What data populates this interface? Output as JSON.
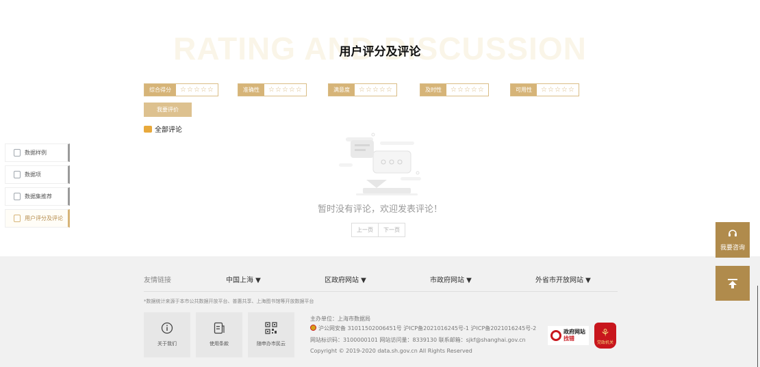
{
  "section": {
    "bg_title": "RATING AND DISCUSSION",
    "title": "用户评分及评论"
  },
  "ratings": [
    {
      "label": "综合得分",
      "stars": 0
    },
    {
      "label": "准确性",
      "stars": 0
    },
    {
      "label": "满意度",
      "stars": 0
    },
    {
      "label": "及时性",
      "stars": 0
    },
    {
      "label": "可用性",
      "stars": 0
    }
  ],
  "star_glyph": "☆",
  "rate_button": "我要评价",
  "all_comments": "全部评论",
  "empty_message": "暂时没有评论，欢迎发表评论！",
  "pager": {
    "prev": "上一页",
    "next": "下一页"
  },
  "side_nav": [
    {
      "label": "数据样例",
      "active": false
    },
    {
      "label": "数据项",
      "active": false
    },
    {
      "label": "数据集推荐",
      "active": false
    },
    {
      "label": "用户评分及评论",
      "active": true
    }
  ],
  "float_buttons": {
    "consult": "我要咨询",
    "top_icon": "arrow-up-to-top-icon"
  },
  "footer": {
    "links_label": "友情链接",
    "links": [
      "中国上海 ▼",
      "区政府网站 ▼",
      "市政府网站 ▼",
      "外省市开放网站 ▼"
    ],
    "source_note": "*数据统计来源于本市公共数据开放平台、普惠共享、上海图书馆等开放数据平台",
    "tiles": [
      {
        "label": "关于我们",
        "icon": "info-icon"
      },
      {
        "label": "使用条款",
        "icon": "document-icon"
      },
      {
        "label": "随申办市民云",
        "icon": "qr-code-icon"
      }
    ],
    "sponsor": "主办单位：上海市数据局",
    "icp": "沪公网安备 31011502006451号  沪ICP备2021016245号-1  沪ICP备2021016245号-2",
    "site_info": "网站标识码：3100000101  网站访问量：8339130  联系邮箱：sjkf@shanghai.gov.cn",
    "copyright": "Copyright © 2019-2020 data.sh.gov.cn All Rights Reserved",
    "gov_badge": {
      "line1": "政府网站",
      "line2": "找错"
    },
    "emblem_text": "党政机关"
  },
  "colors": {
    "accent": "#d6b478",
    "fab": "#b08b4c",
    "gov_red": "#c8161d"
  }
}
